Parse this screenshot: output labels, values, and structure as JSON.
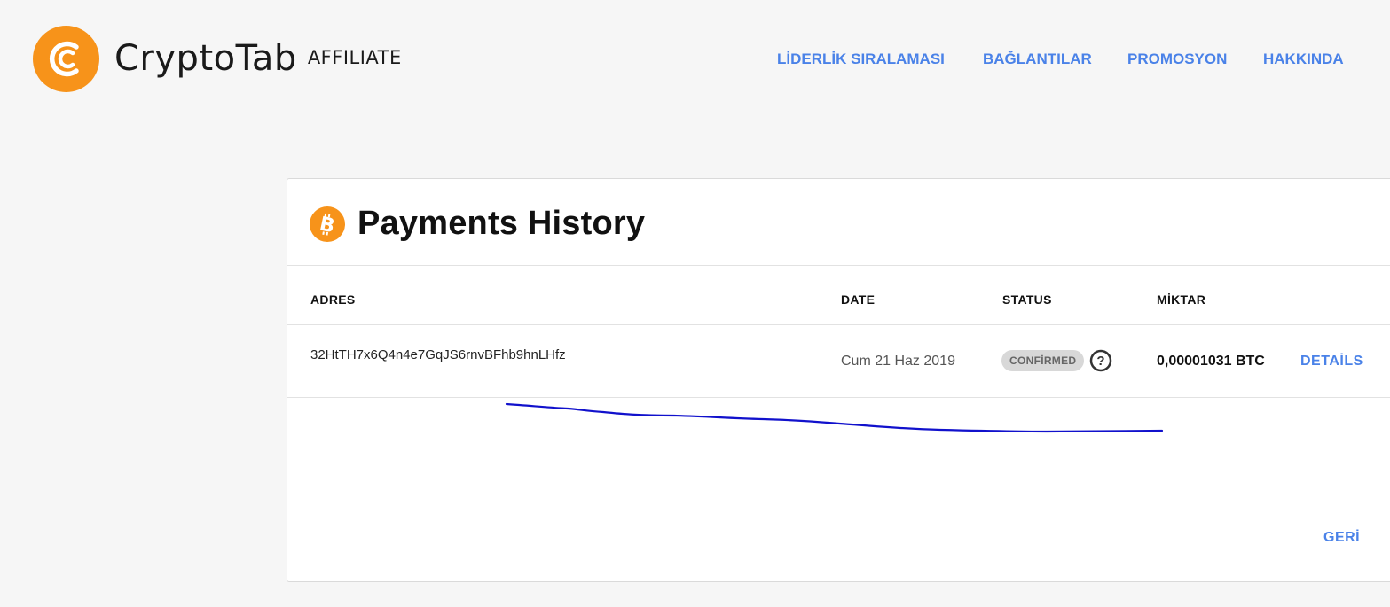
{
  "brand": {
    "name": "CryptoTab",
    "sub": "AFFILIATE",
    "color": "#f7931a"
  },
  "nav": {
    "items": [
      {
        "label": "LİDERLİK SIRALAMASI"
      },
      {
        "label": "BAĞLANTILAR"
      },
      {
        "label": "PROMOSYON"
      },
      {
        "label": "HAKKINDA"
      }
    ],
    "color": "#4a82e8"
  },
  "payments": {
    "title": "Payments History",
    "icon": "bitcoin-icon",
    "columns": [
      "ADRES",
      "DATE",
      "STATUS",
      "MİKTAR"
    ],
    "rows": [
      {
        "address": "32HtTH7x6Q4n4e7GqJS6rnvBFhb9hnLHfz",
        "date": "Cum 21 Haz 2019",
        "status": "CONFİRMED",
        "amount": "0,00001031 BTC",
        "details_label": "DETAİLS"
      }
    ],
    "back_label": "GERİ"
  },
  "annotation": {
    "color": "#1111cc"
  }
}
